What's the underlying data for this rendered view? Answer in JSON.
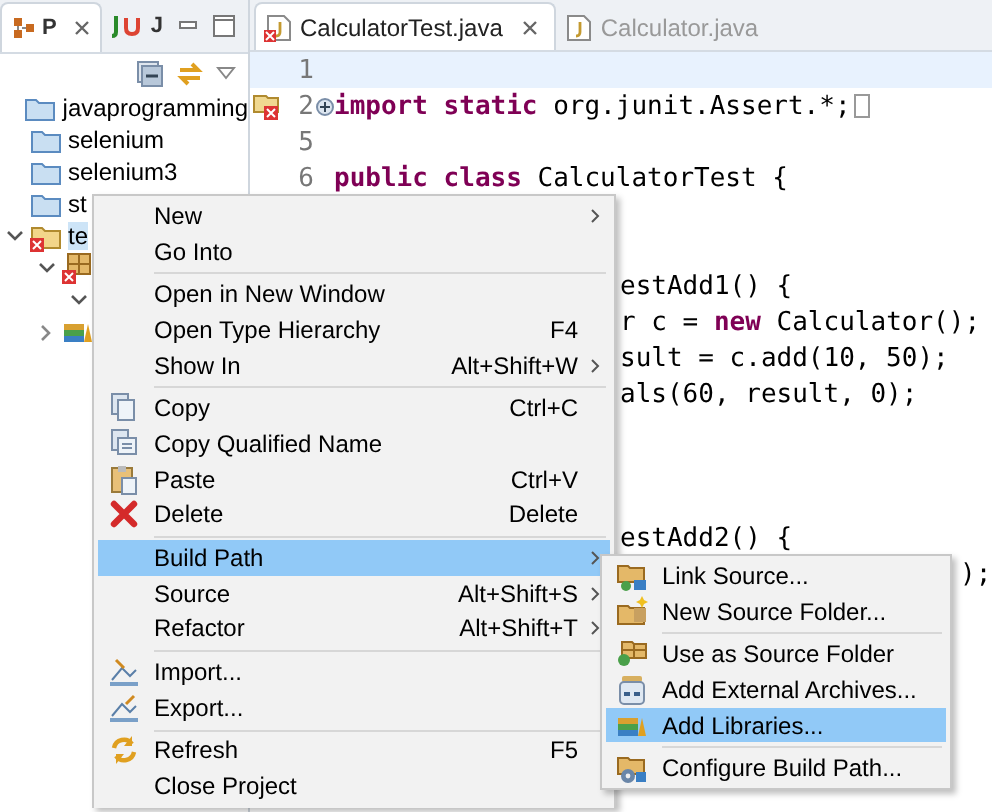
{
  "explorer": {
    "tabs": [
      {
        "label": "P",
        "selected": true,
        "closable": true
      },
      {
        "label": "J",
        "selected": false,
        "closable": false
      }
    ],
    "tree": [
      {
        "kind": "folder",
        "label": "javaprogramming",
        "selected": false
      },
      {
        "kind": "folder",
        "label": "selenium",
        "selected": false
      },
      {
        "kind": "folder",
        "label": "selenium3",
        "selected": false
      },
      {
        "kind": "folder",
        "label": "st",
        "selected": false
      },
      {
        "kind": "project",
        "label": "te",
        "selected": true,
        "expanded": true,
        "children": [
          {
            "kind": "package",
            "expanded": true,
            "children": [
              {
                "expanded": true
              }
            ]
          },
          {
            "kind": "library",
            "expanded": false
          }
        ]
      }
    ]
  },
  "editor": {
    "tabs": [
      {
        "label": "CalculatorTest.java",
        "selected": true,
        "closable": true
      },
      {
        "label": "Calculator.java",
        "selected": false,
        "closable": false
      }
    ],
    "lines": [
      {
        "kind": "full",
        "number": "1",
        "current": true
      },
      {
        "kind": "full",
        "number": "2",
        "text": "**import static** org.junit.Assert.*;",
        "folded": true,
        "error_marker": true
      },
      {
        "kind": "full",
        "number": "5"
      },
      {
        "kind": "full",
        "number": "6",
        "text": "**public class** CalculatorTest {"
      },
      {
        "kind": "partial"
      },
      {
        "kind": "partial"
      },
      {
        "kind": "partial",
        "text": "estAdd1() {"
      },
      {
        "kind": "partial",
        "text": "r c = **new** Calculator();"
      },
      {
        "kind": "partial",
        "text": "sult = c.add(10, 50);"
      },
      {
        "kind": "partial",
        "text": "als(60, result, 0);"
      },
      {
        "kind": "partial"
      },
      {
        "kind": "partial"
      },
      {
        "kind": "partial"
      },
      {
        "kind": "partial",
        "text": "estAdd2() {"
      },
      {
        "kind": "tail",
        "text": ");"
      }
    ]
  },
  "context_menu": {
    "items": [
      {
        "kind": "item",
        "label": "New",
        "submenu": true,
        "selected": false
      },
      {
        "kind": "item",
        "label": "Go Into",
        "selected": false
      },
      {
        "kind": "separator"
      },
      {
        "kind": "item",
        "label": "Open in New Window",
        "selected": false
      },
      {
        "kind": "item",
        "label": "Open Type Hierarchy",
        "shortcut": "F4",
        "selected": false
      },
      {
        "kind": "item",
        "label": "Show In",
        "shortcut": "Alt+Shift+W",
        "submenu": true,
        "selected": false
      },
      {
        "kind": "separator"
      },
      {
        "kind": "item",
        "label": "Copy",
        "shortcut": "Ctrl+C",
        "selected": false
      },
      {
        "kind": "item",
        "label": "Copy Qualified Name",
        "selected": false
      },
      {
        "kind": "item",
        "label": "Paste",
        "shortcut": "Ctrl+V",
        "selected": false
      },
      {
        "kind": "item",
        "label": "Delete",
        "shortcut": "Delete",
        "selected": false
      },
      {
        "kind": "separator"
      },
      {
        "kind": "item",
        "label": "Build Path",
        "submenu": true,
        "selected": true
      },
      {
        "kind": "item",
        "label": "Source",
        "shortcut": "Alt+Shift+S",
        "submenu": true,
        "selected": false
      },
      {
        "kind": "item",
        "label": "Refactor",
        "shortcut": "Alt+Shift+T",
        "submenu": true,
        "selected": false
      },
      {
        "kind": "separator"
      },
      {
        "kind": "item",
        "label": "Import...",
        "selected": false
      },
      {
        "kind": "item",
        "label": "Export...",
        "selected": false
      },
      {
        "kind": "separator"
      },
      {
        "kind": "item",
        "label": "Refresh",
        "shortcut": "F5",
        "selected": false
      },
      {
        "kind": "item",
        "label": "Close Project",
        "selected": false
      }
    ]
  },
  "submenu": {
    "items": [
      {
        "kind": "item",
        "label": "Link Source...",
        "selected": false
      },
      {
        "kind": "item",
        "label": "New Source Folder...",
        "selected": false
      },
      {
        "kind": "separator"
      },
      {
        "kind": "item",
        "label": "Use as Source Folder",
        "selected": false
      },
      {
        "kind": "item",
        "label": "Add External Archives...",
        "selected": false
      },
      {
        "kind": "item",
        "label": "Add Libraries...",
        "selected": true
      },
      {
        "kind": "separator"
      },
      {
        "kind": "item",
        "label": "Configure Build Path...",
        "selected": false
      }
    ]
  }
}
